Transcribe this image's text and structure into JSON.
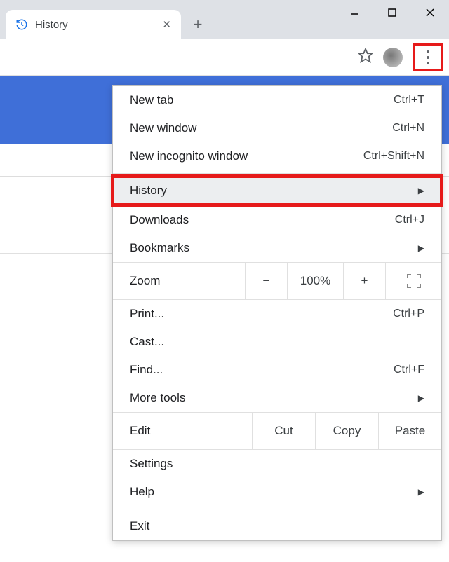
{
  "tab": {
    "title": "History"
  },
  "menu": {
    "new_tab": {
      "label": "New tab",
      "shortcut": "Ctrl+T"
    },
    "new_window": {
      "label": "New window",
      "shortcut": "Ctrl+N"
    },
    "new_incognito": {
      "label": "New incognito window",
      "shortcut": "Ctrl+Shift+N"
    },
    "history": {
      "label": "History"
    },
    "downloads": {
      "label": "Downloads",
      "shortcut": "Ctrl+J"
    },
    "bookmarks": {
      "label": "Bookmarks"
    },
    "zoom": {
      "label": "Zoom",
      "value": "100%",
      "minus": "−",
      "plus": "+"
    },
    "print": {
      "label": "Print...",
      "shortcut": "Ctrl+P"
    },
    "cast": {
      "label": "Cast..."
    },
    "find": {
      "label": "Find...",
      "shortcut": "Ctrl+F"
    },
    "more_tools": {
      "label": "More tools"
    },
    "edit": {
      "label": "Edit",
      "cut": "Cut",
      "copy": "Copy",
      "paste": "Paste"
    },
    "settings": {
      "label": "Settings"
    },
    "help": {
      "label": "Help"
    },
    "exit": {
      "label": "Exit"
    }
  }
}
